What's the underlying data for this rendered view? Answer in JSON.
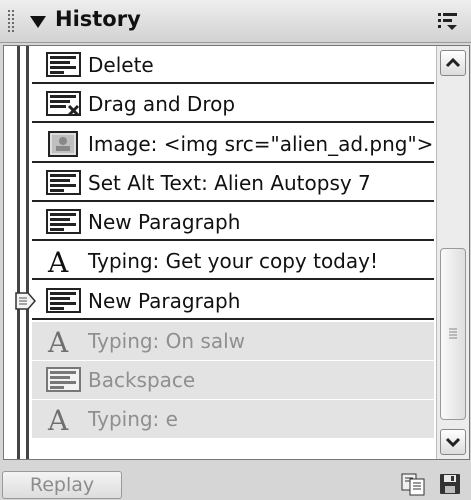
{
  "header": {
    "title": "History"
  },
  "history": {
    "items": [
      {
        "label": "Delete",
        "icon": "text-block-icon",
        "state": "done"
      },
      {
        "label": "Drag and Drop",
        "icon": "drag-drop-icon",
        "state": "done"
      },
      {
        "label": "Image: <img src=\"alien_ad.png\">",
        "icon": "image-icon",
        "state": "done"
      },
      {
        "label": "Set Alt Text: Alien Autopsy 7",
        "icon": "text-block-icon",
        "state": "done"
      },
      {
        "label": "New Paragraph",
        "icon": "text-block-icon",
        "state": "done"
      },
      {
        "label": "Typing: Get your copy today!",
        "icon": "typing-icon",
        "state": "done"
      },
      {
        "label": "New Paragraph",
        "icon": "text-block-icon",
        "state": "current"
      },
      {
        "label": "Typing: On salw",
        "icon": "typing-icon",
        "state": "undone"
      },
      {
        "label": "Backspace",
        "icon": "text-block-icon",
        "state": "undone"
      },
      {
        "label": "Typing: e",
        "icon": "typing-icon",
        "state": "undone"
      }
    ]
  },
  "footer": {
    "replay_label": "Replay"
  },
  "colors": {
    "undone_bg": "#e3e3e3",
    "undone_text": "#8f8f8f"
  }
}
